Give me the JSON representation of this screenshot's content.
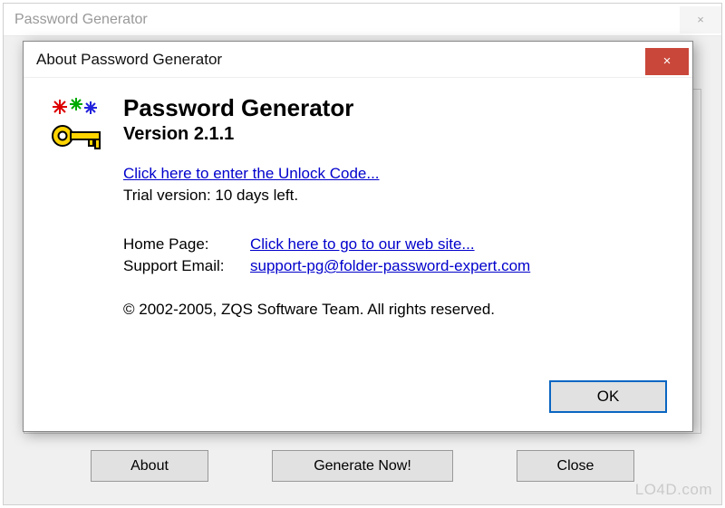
{
  "parent": {
    "title": "Password Generator",
    "close_label": "×",
    "buttons": {
      "about": "About",
      "generate": "Generate Now!",
      "close": "Close"
    }
  },
  "dialog": {
    "title": "About Password Generator",
    "close_label": "×",
    "app_name": "Password Generator",
    "version_label": "Version 2.1.1",
    "unlock_link": "Click here to enter the Unlock Code...",
    "trial_text": "Trial version: 10 days left.",
    "homepage_label": "Home Page:",
    "homepage_link": "Click here to go to our web site...",
    "support_label": "Support Email:",
    "support_link": "support-pg@folder-password-expert.com",
    "copyright": "© 2002-2005, ZQS Software Team. All rights reserved.",
    "ok_label": "OK"
  },
  "watermark": "LO4D.com"
}
